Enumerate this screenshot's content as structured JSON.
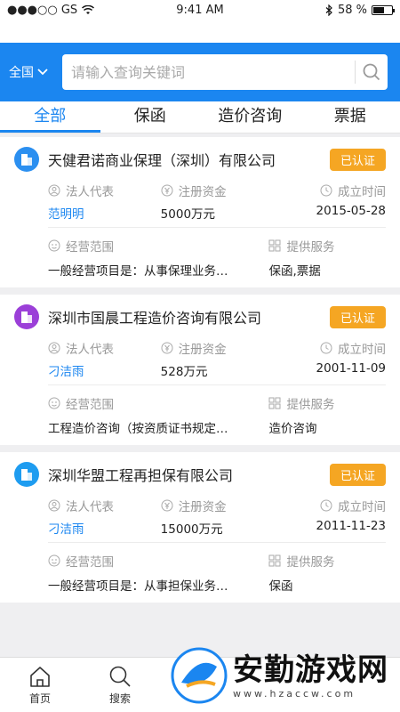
{
  "status_bar": {
    "carrier": "●●●○○ GS",
    "time": "9:41 AM",
    "battery": "58 %",
    "battery_level": 0.58
  },
  "header": {
    "region": "全国",
    "search_placeholder": "请输入查询关键词"
  },
  "tabs": [
    {
      "label": "全部",
      "active": true
    },
    {
      "label": "保函",
      "active": false
    },
    {
      "label": "造价咨询",
      "active": false
    },
    {
      "label": "票据",
      "active": false
    }
  ],
  "labels": {
    "legal_rep": "法人代表",
    "capital": "注册资金",
    "founded": "成立时间",
    "scope": "经营范围",
    "services": "提供服务"
  },
  "companies": [
    {
      "name": "天健君诺商业保理（深圳）有限公司",
      "badge": "已认证",
      "icon_color": "#2b8ff0",
      "legal_rep": "范明明",
      "capital": "5000万元",
      "founded": "2015-05-28",
      "scope": "一般经营项目是：从事保理业务…",
      "services": "保函,票据"
    },
    {
      "name": "深圳市国晨工程造价咨询有限公司",
      "badge": "已认证",
      "icon_color": "#9b3fd8",
      "legal_rep": "刁洁雨",
      "capital": "528万元",
      "founded": "2001-11-09",
      "scope": "工程造价咨询（按资质证书规定…",
      "services": "造价咨询"
    },
    {
      "name": "深圳华盟工程再担保有限公司",
      "badge": "已认证",
      "icon_color": "#1e9cf0",
      "legal_rep": "刁洁雨",
      "capital": "15000万元",
      "founded": "2011-11-23",
      "scope": "一般经营项目是：从事担保业务…",
      "services": "保函"
    }
  ],
  "bottom_nav": [
    {
      "label": "首页",
      "icon": "home-icon"
    },
    {
      "label": "搜索",
      "icon": "search-icon"
    }
  ],
  "watermark": {
    "title": "安勤游戏网",
    "url": "www.hzaccw.com"
  }
}
